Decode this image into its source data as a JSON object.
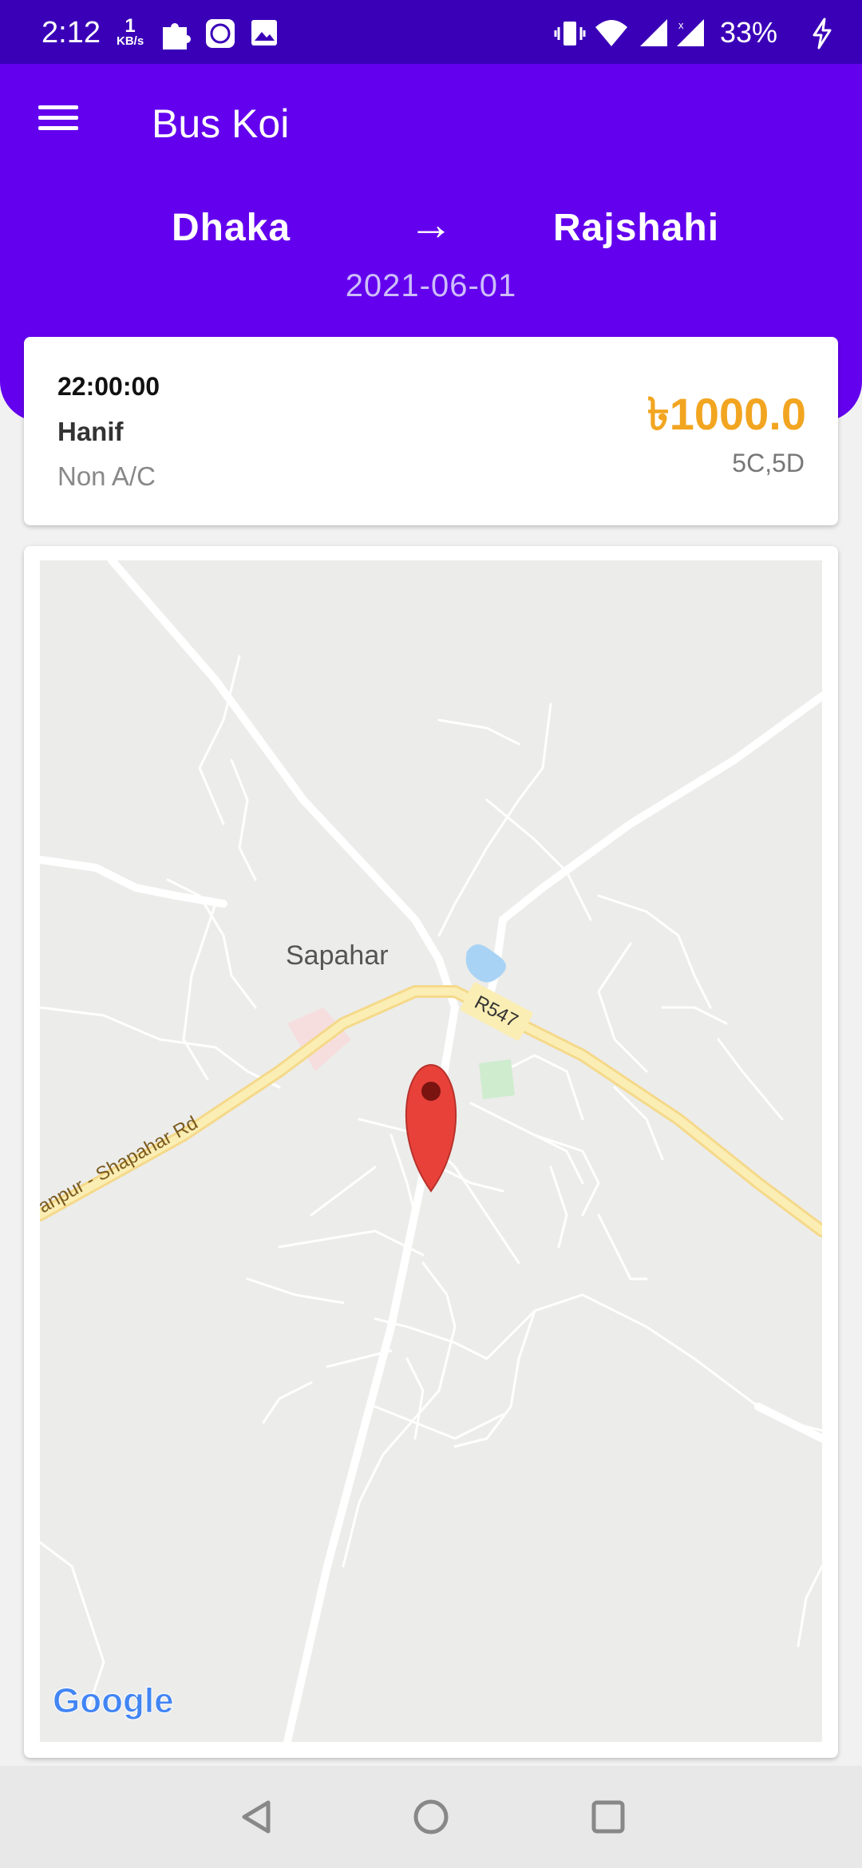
{
  "status": {
    "time": "2:12",
    "net_speed_value": "1",
    "net_speed_unit": "KB/s",
    "battery": "33%"
  },
  "app": {
    "title": "Bus Koi"
  },
  "route": {
    "from": "Dhaka",
    "arrow": "→",
    "to": "Rajshahi",
    "date": "2021-06-01"
  },
  "trip": {
    "time": "22:00:00",
    "operator": "Hanif",
    "bus_type": "Non A/C",
    "price": "৳1000.0",
    "seats": "5C,5D"
  },
  "map": {
    "town_label": "Sapahar",
    "road_label": "R547",
    "road_label_2": "anpur - Shapahar Rd",
    "attribution": "Google"
  },
  "colors": {
    "primary": "#6300ee",
    "status_bar": "#3a00b8",
    "price": "#f2a520",
    "pin": "#e8413a"
  },
  "icons": {
    "menu": "hamburger-icon",
    "pin": "map-pin-icon",
    "back": "back-triangle-icon",
    "home": "home-circle-icon",
    "recents": "recents-square-icon"
  }
}
